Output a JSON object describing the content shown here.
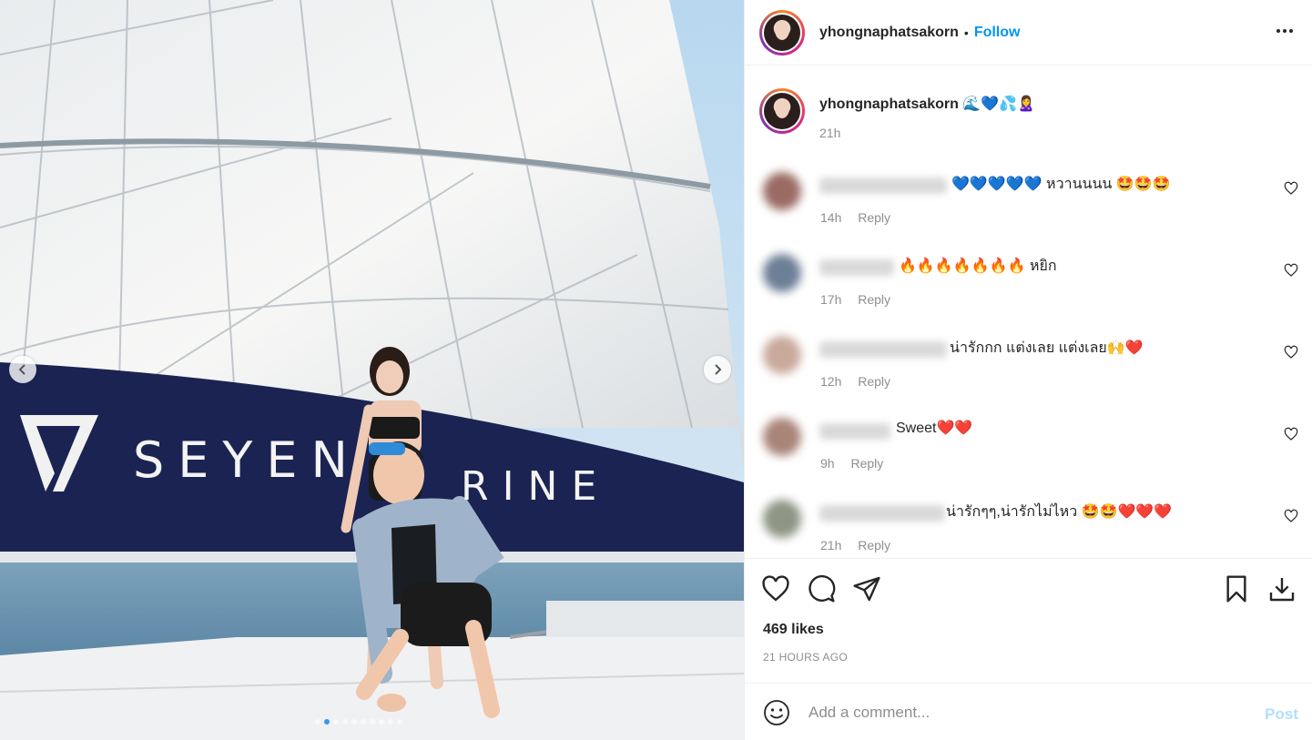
{
  "photo": {
    "brand_left": "SEYEN",
    "brand_right": "RINE",
    "slide_count": 10,
    "active_slide": 2
  },
  "header": {
    "username": "yhongnaphatsakorn",
    "separator": "•",
    "follow_label": "Follow"
  },
  "caption": {
    "username": "yhongnaphatsakorn",
    "text": "🌊💙💦🙎‍♀️",
    "time": "21h"
  },
  "comments": [
    {
      "text": "💙💙💙💙💙 หวานนนน 🤩🤩🤩",
      "time": "14h",
      "reply": "Reply",
      "avatar_color": "#9a6a63"
    },
    {
      "text": "🔥🔥🔥🔥🔥🔥🔥 หยิก",
      "time": "17h",
      "reply": "Reply",
      "avatar_color": "#6d7f96"
    },
    {
      "text": "น่ารักกก แต่งเลย แต่งเลย🙌❤️",
      "time": "12h",
      "reply": "Reply",
      "avatar_color": "#c9a99b"
    },
    {
      "text": "Sweet❤️❤️",
      "time": "9h",
      "reply": "Reply",
      "avatar_color": "#a98478"
    },
    {
      "text": "น่ารักๆๆ,น่ารักไม่ไหว 🤩🤩❤️❤️❤️",
      "time": "21h",
      "reply": "Reply",
      "avatar_color": "#8e9585"
    }
  ],
  "actions": {
    "likes": "469 likes",
    "time_ago": "21 HOURS AGO"
  },
  "add_comment": {
    "placeholder": "Add a comment...",
    "post_label": "Post"
  },
  "colors": {
    "accent": "#0095f6",
    "post_disabled": "#b2dffc",
    "muted": "#8e8e8e"
  }
}
